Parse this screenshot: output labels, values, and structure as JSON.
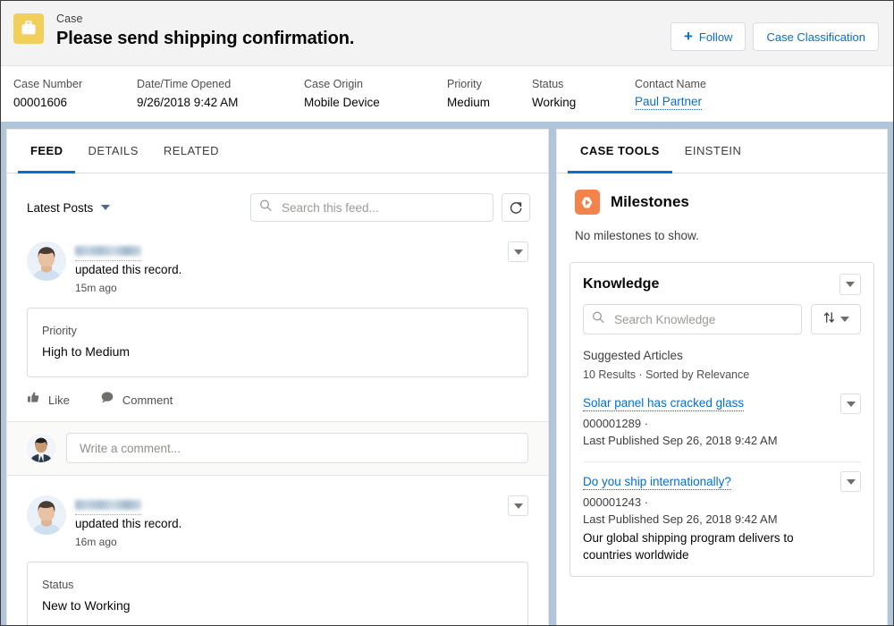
{
  "header": {
    "icon": "briefcase-icon",
    "icon_bg": "#f2cf5b",
    "eyebrow": "Case",
    "title": "Please send shipping confirmation.",
    "actions": {
      "follow_label": "Follow",
      "follow_icon": "plus-icon",
      "classification_label": "Case Classification"
    }
  },
  "highlight_fields": [
    {
      "label": "Case Number",
      "value": "00001606",
      "link": false
    },
    {
      "label": "Date/Time Opened",
      "value": "9/26/2018 9:42 AM",
      "link": false
    },
    {
      "label": "Case Origin",
      "value": "Mobile Device",
      "link": false
    },
    {
      "label": "Priority",
      "value": "Medium",
      "link": false
    },
    {
      "label": "Status",
      "value": "Working",
      "link": false
    },
    {
      "label": "Contact Name",
      "value": "Paul Partner",
      "link": true
    }
  ],
  "left_panel": {
    "tabs": [
      {
        "label": "FEED",
        "active": true
      },
      {
        "label": "DETAILS",
        "active": false
      },
      {
        "label": "RELATED",
        "active": false
      }
    ],
    "feed_controls": {
      "sort_label": "Latest Posts",
      "sort_icon": "chevron-down-icon",
      "search_placeholder": "Search this feed...",
      "search_value": "",
      "search_icon": "search-icon",
      "refresh_icon": "refresh-icon"
    },
    "posts": [
      {
        "author": "",
        "author_redacted": true,
        "action_text": "updated this record.",
        "timestamp": "15m ago",
        "menu_icon": "chevron-down-icon",
        "change": {
          "label": "Priority",
          "value": "High to Medium"
        },
        "actions": [
          {
            "label": "Like",
            "icon": "thumbs-up-icon"
          },
          {
            "label": "Comment",
            "icon": "comment-bubble-icon"
          }
        ],
        "comment_box": {
          "placeholder": "Write a comment...",
          "value": ""
        }
      },
      {
        "author": "",
        "author_redacted": true,
        "action_text": "updated this record.",
        "timestamp": "16m ago",
        "menu_icon": "chevron-down-icon",
        "change": {
          "label": "Status",
          "value": "New to Working"
        }
      }
    ]
  },
  "right_panel": {
    "tabs": [
      {
        "label": "CASE TOOLS",
        "active": true
      },
      {
        "label": "EINSTEIN",
        "active": false
      }
    ],
    "milestones": {
      "icon": "milestone-icon",
      "icon_bg": "#f3834a",
      "title": "Milestones",
      "empty_text": "No milestones to show."
    },
    "knowledge": {
      "title": "Knowledge",
      "menu_icon": "chevron-down-icon",
      "search_placeholder": "Search Knowledge",
      "search_value": "",
      "search_icon": "search-icon",
      "sort_icon": "sort-arrows-icon",
      "sort_caret_icon": "chevron-down-icon",
      "suggested_label": "Suggested Articles",
      "results_summary": "10 Results · Sorted by Relevance",
      "articles": [
        {
          "title": "Solar panel has cracked glass",
          "number": "000001289  ·",
          "published": "Last Published  Sep 26, 2018 9:42 AM",
          "snippet": "",
          "menu_icon": "chevron-down-icon"
        },
        {
          "title": "Do you ship internationally?",
          "number": "000001243  ·",
          "published": "Last Published  Sep 26, 2018 9:42 AM",
          "snippet": "Our global shipping program delivers to countries worldwide",
          "menu_icon": "chevron-down-icon"
        }
      ]
    }
  },
  "colors": {
    "brand_blue": "#0070d2",
    "page_bg": "#b2c4d8",
    "header_bg": "#f3f3f3",
    "case_icon": "#f2cf5b",
    "milestone_icon": "#f3834a"
  }
}
